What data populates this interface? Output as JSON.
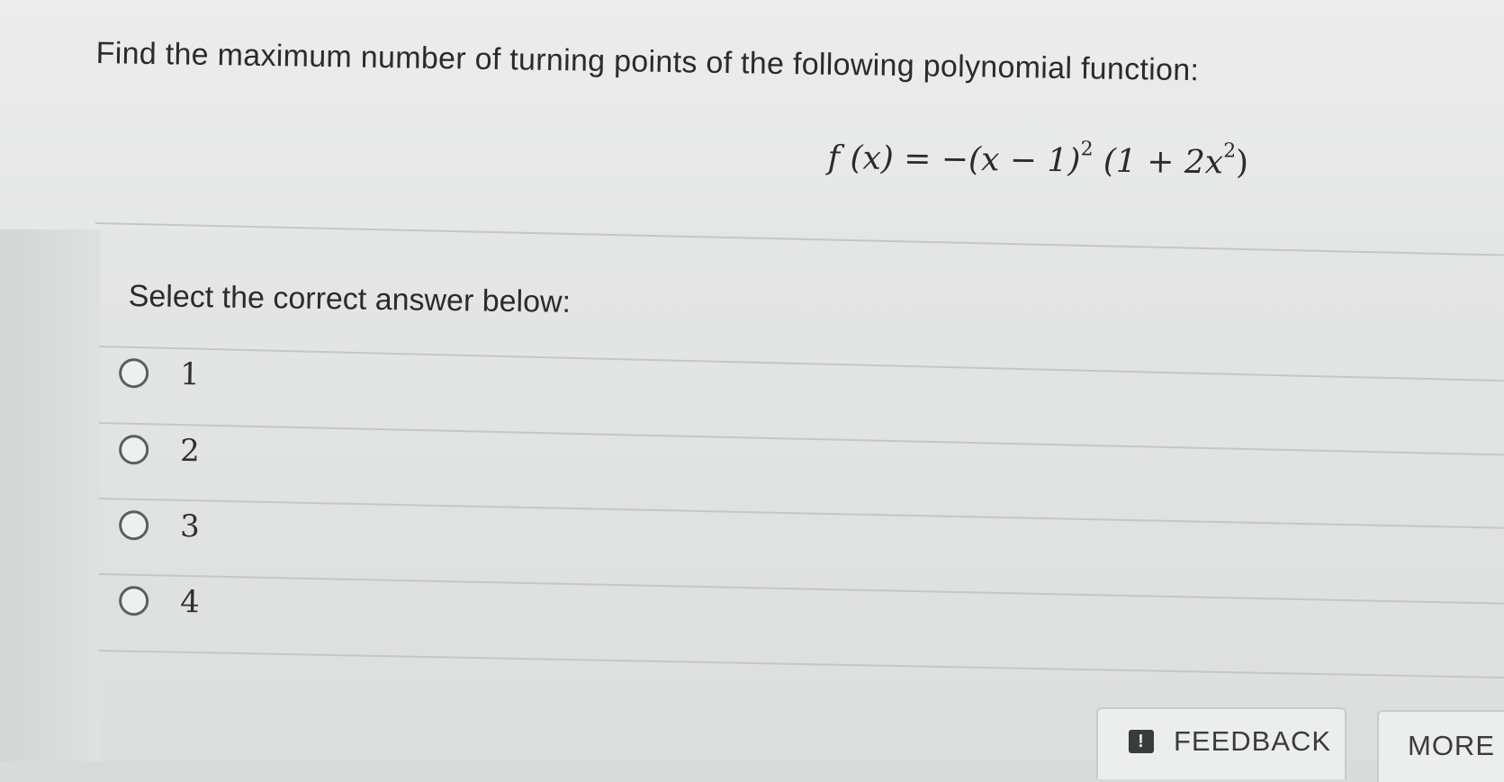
{
  "question": {
    "prompt": "Find the maximum number of turning points of the following polynomial function:",
    "formula": {
      "lhs": "f (x) = −(x − 1)",
      "exp1": "2",
      "mid": " (1 + 2x",
      "exp2": "2",
      "end": ")"
    }
  },
  "answers": {
    "instruction": "Select the correct answer below:",
    "options": [
      {
        "label": "1"
      },
      {
        "label": "2"
      },
      {
        "label": "3"
      },
      {
        "label": "4"
      }
    ]
  },
  "footer": {
    "feedback_icon": "!",
    "feedback_label": "FEEDBACK",
    "more_label": "MORE"
  }
}
